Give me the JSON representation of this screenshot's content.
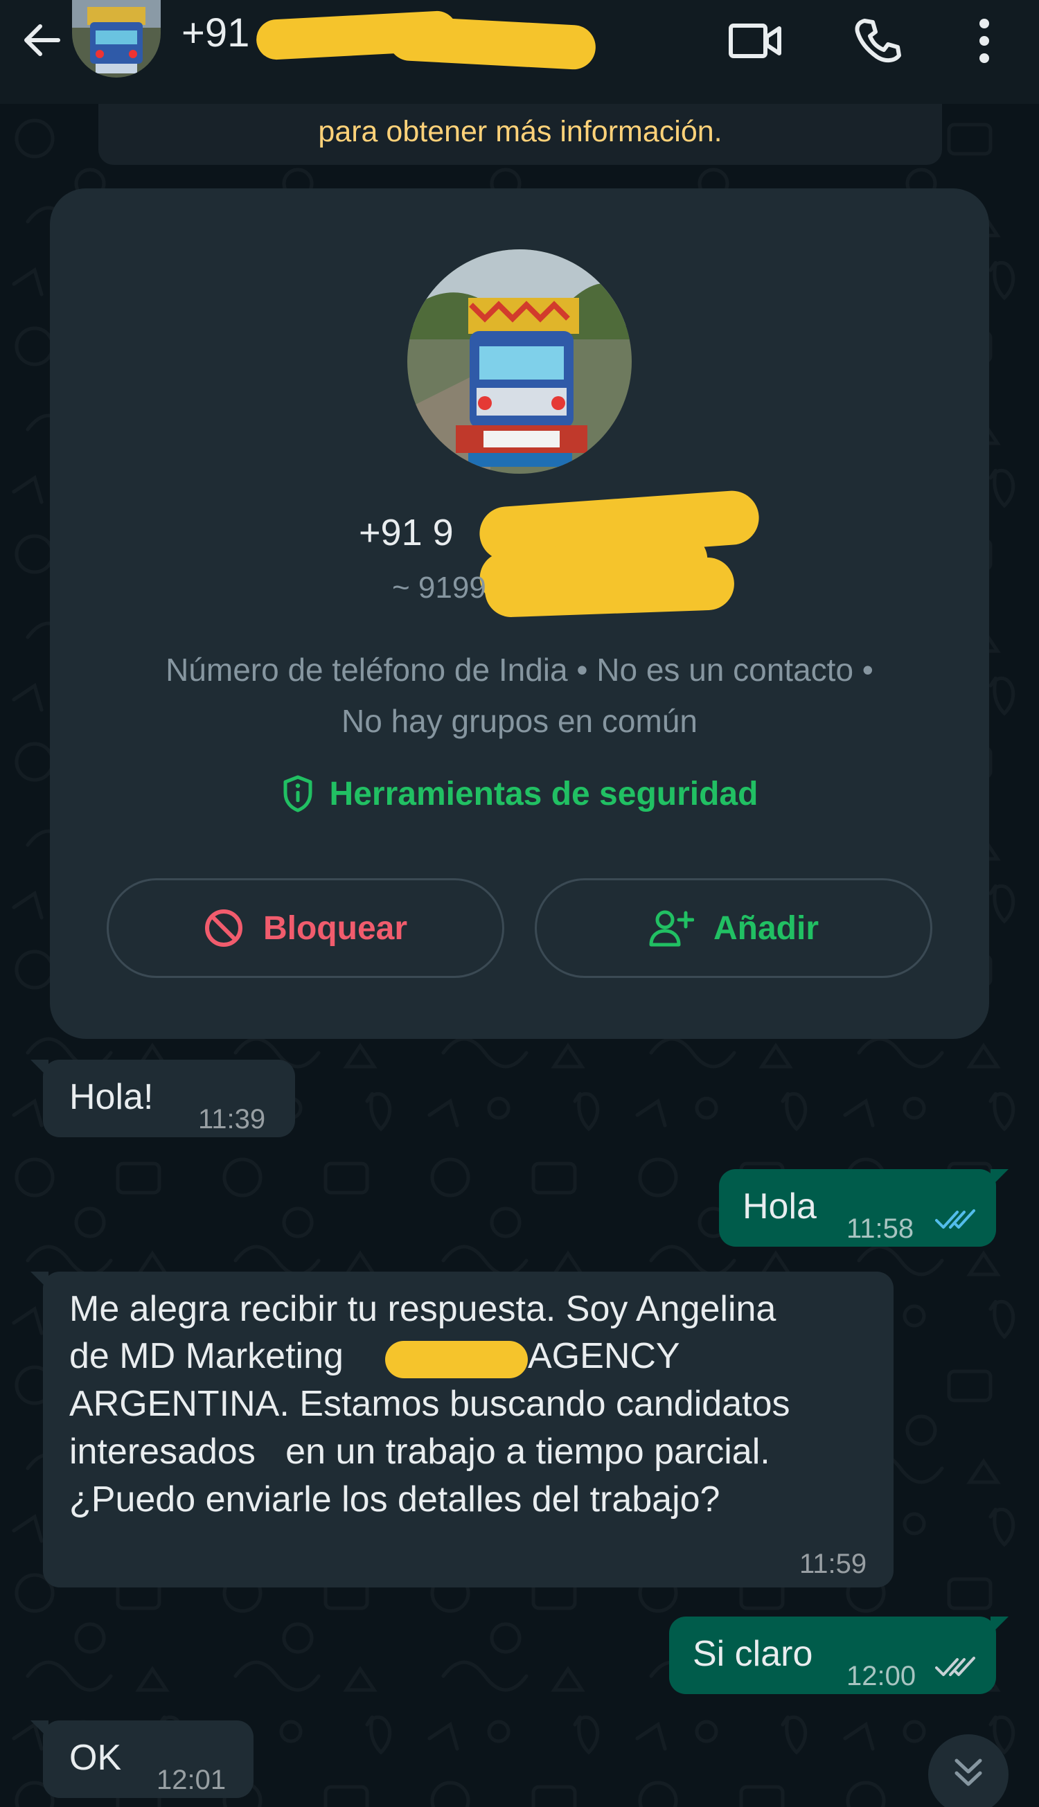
{
  "header": {
    "title": "+91",
    "icons": {
      "back": "arrow-left-icon",
      "video": "video-call-icon",
      "call": "phone-icon",
      "menu": "more-vert-icon"
    }
  },
  "notice": {
    "text": "para obtener más información."
  },
  "contact_card": {
    "phone": "+91 9",
    "push_name": "~ 9199",
    "info_line1": "Número de teléfono de India • No es un contacto •",
    "info_line2": "No hay grupos en común",
    "security_tools": "Herramientas de seguridad",
    "block_label": "Bloquear",
    "add_label": "Añadir"
  },
  "messages": [
    {
      "direction": "in",
      "text": "Hola!",
      "time": "11:39"
    },
    {
      "direction": "out",
      "text": "Hola",
      "time": "11:58",
      "status": "read"
    },
    {
      "direction": "in",
      "lines": [
        "Me alegra recibir tu respuesta. Soy Angelina",
        "de MD Marketing",
        "AGENCY",
        "ARGENTINA. Estamos buscando candidatos",
        "interesados   en un trabajo a tiempo parcial.",
        "¿Puedo enviarle los detalles del trabajo?"
      ],
      "time": "11:59"
    },
    {
      "direction": "out",
      "text": "Si claro",
      "time": "12:00",
      "status": "read"
    },
    {
      "direction": "in",
      "text": "OK",
      "time": "12:01"
    }
  ],
  "colors": {
    "background": "#0b141a",
    "header": "#111b21",
    "incoming_bubble": "#1f2c34",
    "outgoing_bubble": "#005c4b",
    "accent_green": "#21c063",
    "danger_red": "#f15c6d",
    "notice_text": "#ffd279",
    "read_ticks": "#53bdeb",
    "redaction": "#f5c42c"
  }
}
